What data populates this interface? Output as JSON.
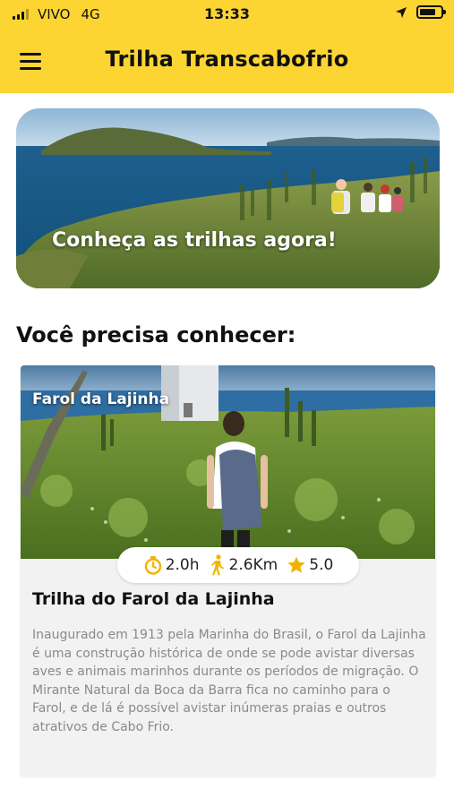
{
  "status_bar": {
    "carrier": "VIVO",
    "network": "4G",
    "time": "13:33"
  },
  "app_bar": {
    "title": "Trilha Transcabofrio",
    "menu_icon": "hamburger-menu-icon"
  },
  "hero": {
    "caption": "Conheça as trilhas agora!"
  },
  "section": {
    "title": "Você precisa conhecer:"
  },
  "trail_card": {
    "image_label": "Farol da Lajinha",
    "stats": {
      "duration": "2.0h",
      "distance": "2.6Km",
      "rating": "5.0"
    },
    "title": "Trilha do Farol da Lajinha",
    "description": "Inaugurado em 1913 pela Marinha do Brasil, o Farol da Lajinha é uma construção histórica de onde se pode avistar diversas aves e animais marinhos durante os períodos de migração. O Mirante Natural da Boca da Barra fica no caminho para o Farol, e de lá é possível avistar inúmeras praias e outros atrativos de Cabo Frio."
  },
  "colors": {
    "accent": "#fcd533",
    "icon_gold": "#f0b400"
  }
}
